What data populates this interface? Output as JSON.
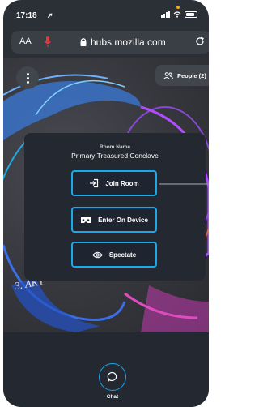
{
  "status_bar": {
    "time": "17:18"
  },
  "browser": {
    "text_size_label": "AA",
    "url": "hubs.mozilla.com"
  },
  "scene": {
    "sign_text": "3. AKT"
  },
  "header": {
    "people_label": "People (2)"
  },
  "room_panel": {
    "room_name_label": "Room Name",
    "room_name": "Primary Treasured Conclave",
    "join_label": "Join Room",
    "enter_device_label": "Enter On Device",
    "spectate_label": "Spectate"
  },
  "bottom_bar": {
    "chat_label": "Chat"
  },
  "colors": {
    "accent": "#1aa8e8",
    "panel_bg": "#232831",
    "chrome_bg": "#2b2f36"
  }
}
